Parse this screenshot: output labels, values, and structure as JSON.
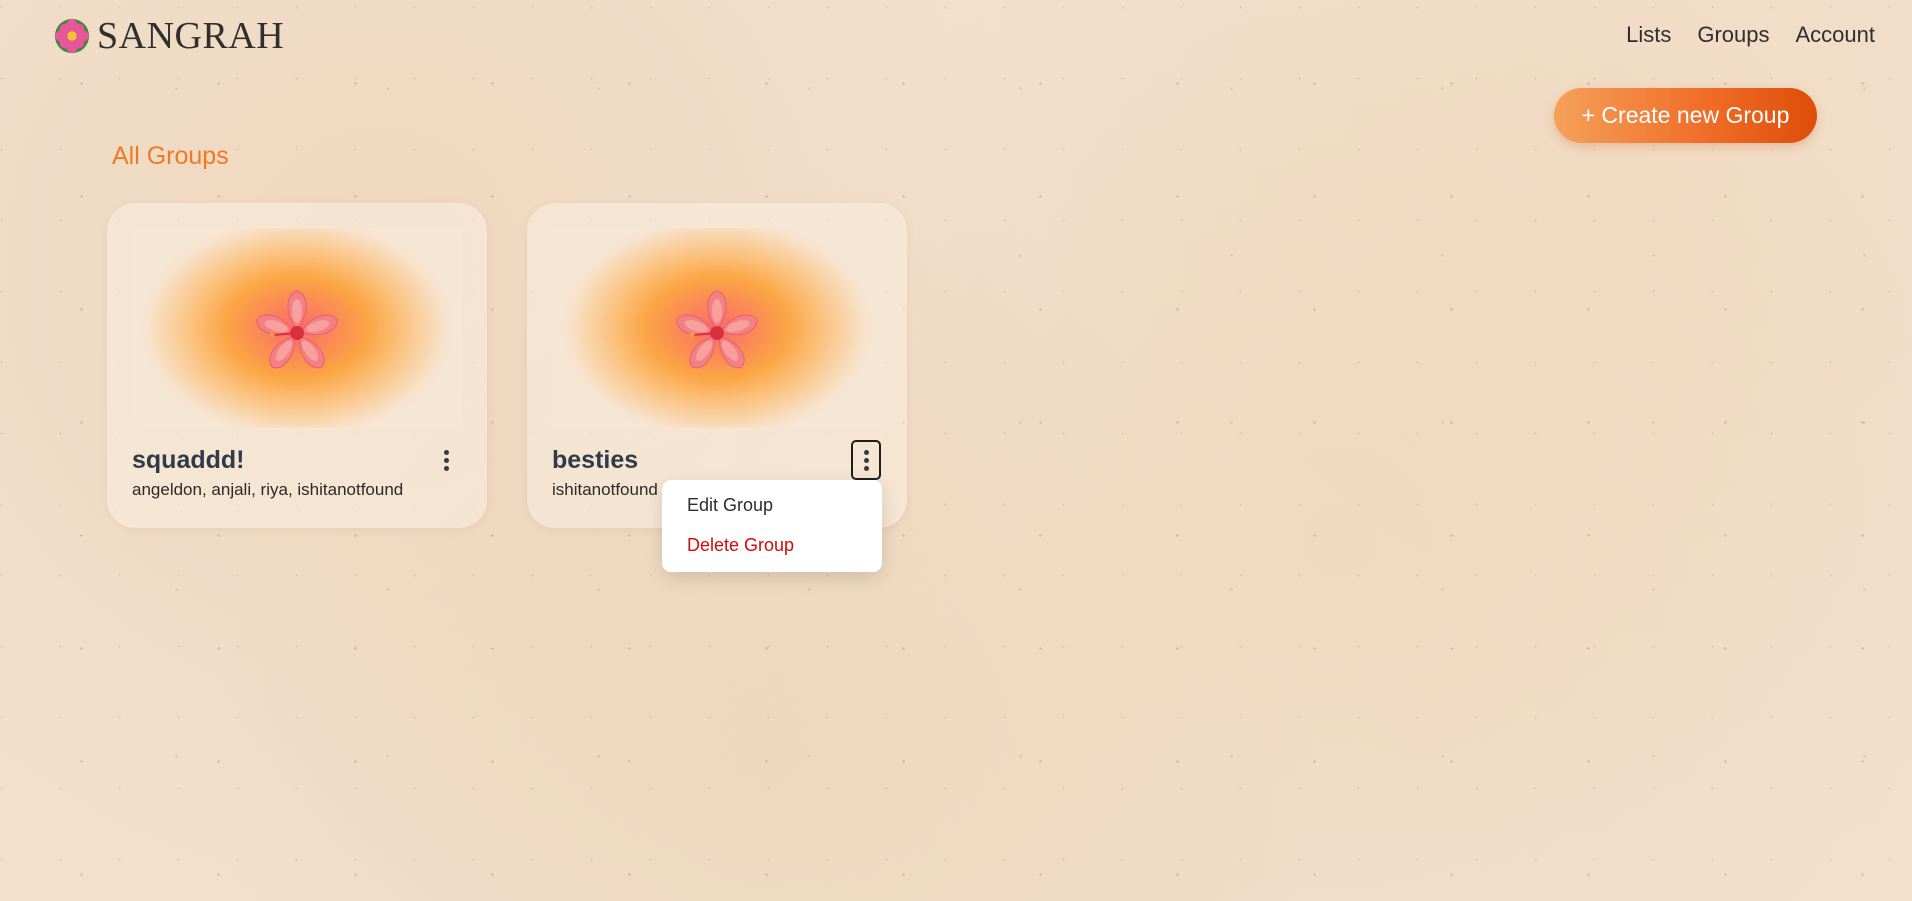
{
  "brand": {
    "name": "SANGRAH",
    "icon": "flower-logo-icon"
  },
  "nav": {
    "items": [
      "Lists",
      "Groups",
      "Account"
    ]
  },
  "actions": {
    "create_group_label": "+ Create new Group"
  },
  "section": {
    "title": "All Groups"
  },
  "groups": [
    {
      "name": "squaddd!",
      "members": "angeldon, anjali, riya, ishitanotfound",
      "image_icon": "hibiscus-icon"
    },
    {
      "name": "besties",
      "members": "ishitanotfound",
      "image_icon": "hibiscus-icon"
    }
  ],
  "group_menu": {
    "edit_label": "Edit Group",
    "delete_label": "Delete Group"
  },
  "colors": {
    "accent_orange": "#f07a22",
    "delete_red": "#d10a0a",
    "background": "#f2e0cc"
  }
}
